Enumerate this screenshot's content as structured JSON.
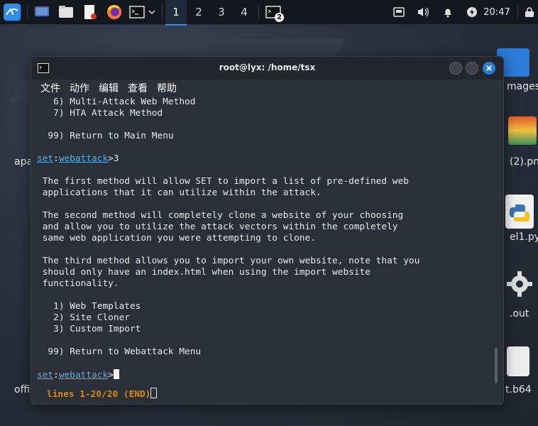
{
  "taskbar": {
    "workspaces": [
      "1",
      "2",
      "3",
      "4"
    ],
    "task_badge": "2",
    "clock": "20:47"
  },
  "desktop": {
    "labels": [
      "apache",
      "(2).pn",
      "el1.py",
      ".out",
      "offic",
      "t.b64",
      "mages"
    ]
  },
  "window": {
    "title": "root@lyx: /home/tsx",
    "menu": [
      "文件",
      "动作",
      "编辑",
      "查看",
      "帮助"
    ]
  },
  "terminal": {
    "lines": [
      "   6) Multi-Attack Web Method",
      "   7) HTA Attack Method",
      "",
      "  99) Return to Main Menu",
      "",
      "__PROMPT__3",
      "",
      " The first method will allow SET to import a list of pre-defined web",
      " applications that it can utilize within the attack.",
      "",
      " The second method will completely clone a website of your choosing",
      " and allow you to utilize the attack vectors within the completely",
      " same web application you were attempting to clone.",
      "",
      " The third method allows you to import your own website, note that you",
      " should only have an index.html when using the import website",
      " functionality.",
      "",
      "   1) Web Templates",
      "   2) Site Cloner",
      "   3) Custom Import",
      "",
      "  99) Return to Webattack Menu",
      "",
      "__PROMPT__"
    ],
    "prompt_set": "set",
    "prompt_module": "webattack",
    "prompt_symbol": ">",
    "status_line": "lines 1-20/20 (END)"
  },
  "colors": {
    "accent": "#2e8de8",
    "prompt": "#5dade2",
    "status": "#d58a15"
  },
  "icons": [
    "kali-menu-icon",
    "desktop-icon",
    "files-icon",
    "text-editor-icon",
    "firefox-icon",
    "terminal-icon",
    "chevron-down-icon",
    "network-icon",
    "volume-icon",
    "bell-icon",
    "power-icon",
    "lock-icon"
  ]
}
